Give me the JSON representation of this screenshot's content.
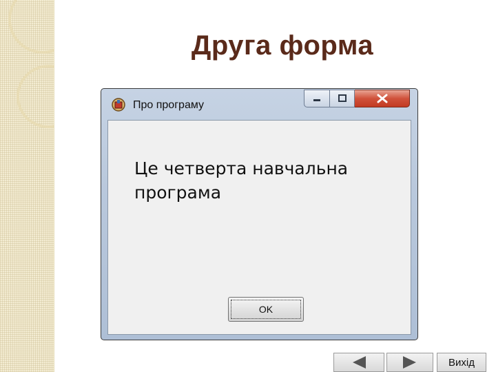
{
  "slide": {
    "title": "Друга форма"
  },
  "window": {
    "title": "Про програму",
    "controls": {
      "minimize_icon": "minimize-icon",
      "maximize_icon": "maximize-icon",
      "close_icon": "close-icon"
    },
    "message": "Це четверта навчальна програма",
    "ok_label": "OK"
  },
  "navigation": {
    "prev_icon": "triangle-left-icon",
    "next_icon": "triangle-right-icon",
    "exit_label": "Вихід"
  },
  "colors": {
    "title": "#5a2a1a",
    "close_button": "#c23a22",
    "window_frame": "#b9c8dc",
    "client_bg": "#f0f0f0"
  }
}
